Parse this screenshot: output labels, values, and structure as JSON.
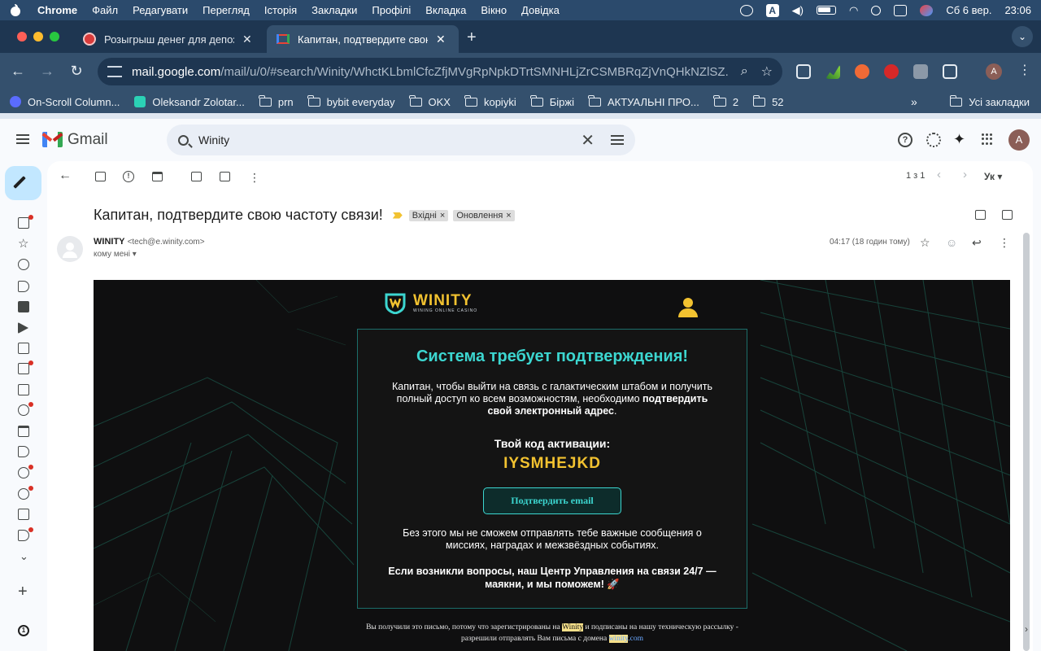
{
  "menubar": {
    "app": "Chrome",
    "items": [
      "Файл",
      "Редагувати",
      "Перегляд",
      "Історія",
      "Закладки",
      "Профілі",
      "Вкладка",
      "Вікно",
      "Довідка"
    ],
    "input_source": "A",
    "date": "Сб 6 вер.",
    "time": "23:06"
  },
  "tabs": [
    {
      "title": "Розыгрыш денег для депози",
      "active": false
    },
    {
      "title": "Капитан, подтвердите свою",
      "active": true
    }
  ],
  "toolbar": {
    "url_host": "mail.google.com",
    "url_path": "/mail/u/0/#search/Winity/WhctKLbmlCfcZfjMVgRpNpkDTrtSMNHLjZrCSMBRqZjVnQHkNZlSZ...",
    "profile_initial": "A"
  },
  "bookmarks": {
    "items": [
      "On-Scroll Column...",
      "Oleksandr Zolotar...",
      "prn",
      "bybit everyday",
      "OKX",
      "kopiyki",
      "Біржі",
      "АКТУАЛЬНІ ПРО...",
      "2",
      "52"
    ],
    "more": "»",
    "all": "Усі закладки"
  },
  "gmail": {
    "product": "Gmail",
    "search_value": "Winity",
    "avatar_initial": "A",
    "pager": "1 з 1",
    "language": "Ук",
    "subject": "Капитан, подтвердите свою частоту связи!",
    "labels": [
      "Вхідні",
      "Оновлення"
    ],
    "sender_name": "WINITY",
    "sender_addr": "<tech@e.winity.com>",
    "to": "кому мені",
    "received": "04:17 (18 годин тому)"
  },
  "email": {
    "brand": "WINITY",
    "brand_sub": "WINING ONLINE CASINO",
    "heading": "Система требует подтверждения!",
    "p1_start": "Капитан, чтобы выйти на связь с галактическим штабом и получить полный доступ ко всем возможностям, необходимо ",
    "p1_bold": "подтвердить свой электронный адрес",
    "p1_end": ".",
    "code_label": "Твой код активации:",
    "code": "IYSMHEJKD",
    "button": "Подтвердить email",
    "p2": "Без этого мы не сможем отправлять тебе важные сообщения о миссиях, наградах и межзвёздных событиях.",
    "p3": "Если возникли вопросы, наш Центр Управления на связи 24/7 — маякни, и мы поможем! 🚀",
    "footer_1": "Вы получили это письмо, потому что зарегистрированы на ",
    "footer_hl1": "Winity",
    "footer_2": " и подписаны на нашу техническую рассылку - разрешили отправлять Вам письма с домена ",
    "footer_hl2": "winity",
    "footer_3": ".com"
  },
  "colors": {
    "accent_teal": "#3cd6d0",
    "accent_gold": "#f2c230",
    "menubar_bg": "#2b4a6c",
    "chrome_toolbar": "#34506d"
  }
}
